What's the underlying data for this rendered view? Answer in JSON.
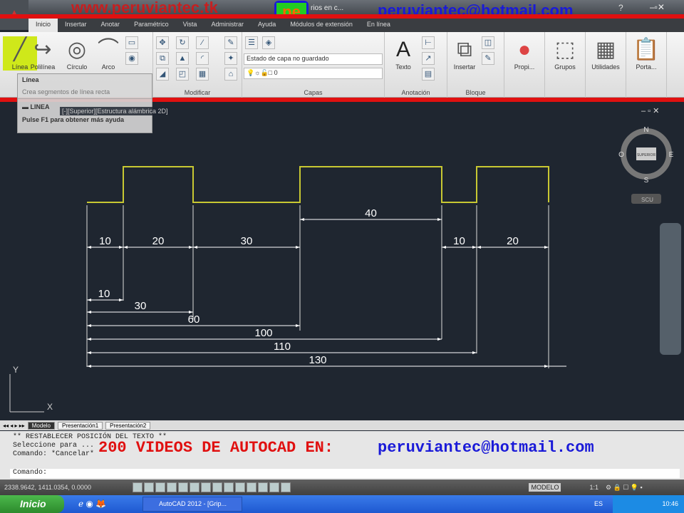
{
  "app": {
    "title_partial": "rios en c...",
    "taskbar_item": "AutoCAD 2012 - [Grip...",
    "start": "Inicio",
    "tray_lang": "ES",
    "clock": "10:46"
  },
  "watermarks": {
    "top_left": "www.peruviantec.tk",
    "top_right": "peruviantec@hotmail.com",
    "bottom_red": "200 VIDEOS DE AUTOCAD EN:",
    "bottom_blue": "peruviantec@hotmail.com",
    "logo": "pe C"
  },
  "tabs": [
    "Inicio",
    "Insertar",
    "Anotar",
    "Paramétrico",
    "Vista",
    "Administrar",
    "Ayuda",
    "Módulos de extensión",
    "En línea"
  ],
  "ribbon": {
    "draw": {
      "linea": "Línea",
      "polilinea": "Polilínea",
      "circulo": "Círculo",
      "arco": "Arco"
    },
    "modify_label": "Modificar",
    "layers": {
      "state": "Estado de capa no guardado",
      "layer": "0",
      "label": "Capas"
    },
    "annotation": {
      "texto": "Texto",
      "label": "Anotación"
    },
    "block": {
      "insertar": "Insertar",
      "label": "Bloque"
    },
    "others": [
      "Propi...",
      "Grupos",
      "Utilidades",
      "Porta..."
    ]
  },
  "tooltip": {
    "title": "Línea",
    "desc": "Crea segmentos de línea recta",
    "command": "LINEA",
    "help": "Pulse F1 para obtener más ayuda"
  },
  "viewport": {
    "label": "[-][Superior][Estructura alámbrica 2D]",
    "compass": {
      "n": "N",
      "s": "S",
      "e": "E",
      "o": "O",
      "center": "SUPERIOR"
    },
    "ucs": "SCU"
  },
  "dimensions": {
    "chain": [
      "10",
      "20",
      "30",
      "40",
      "10",
      "20"
    ],
    "baseline": [
      "10",
      "30",
      "60",
      "100",
      "110",
      "130"
    ]
  },
  "layout_tabs": [
    "Modelo",
    "Presentación1",
    "Presentación2"
  ],
  "command": {
    "lines": [
      "** RESTABLECER POSICIÓN DEL TEXTO **",
      "Seleccione para ...",
      "Comando: *Cancelar*"
    ],
    "prompt": "Comando:"
  },
  "status": {
    "coords": "2338.9642, 1411.0354, 0.0000",
    "model": "MODELO",
    "scale": "1:1"
  },
  "colors": {
    "profile": "#c8c832",
    "dimension": "#ffffff",
    "background": "#1f2630",
    "watermark_red": "#e01010",
    "watermark_blue": "#1a1ad8"
  }
}
